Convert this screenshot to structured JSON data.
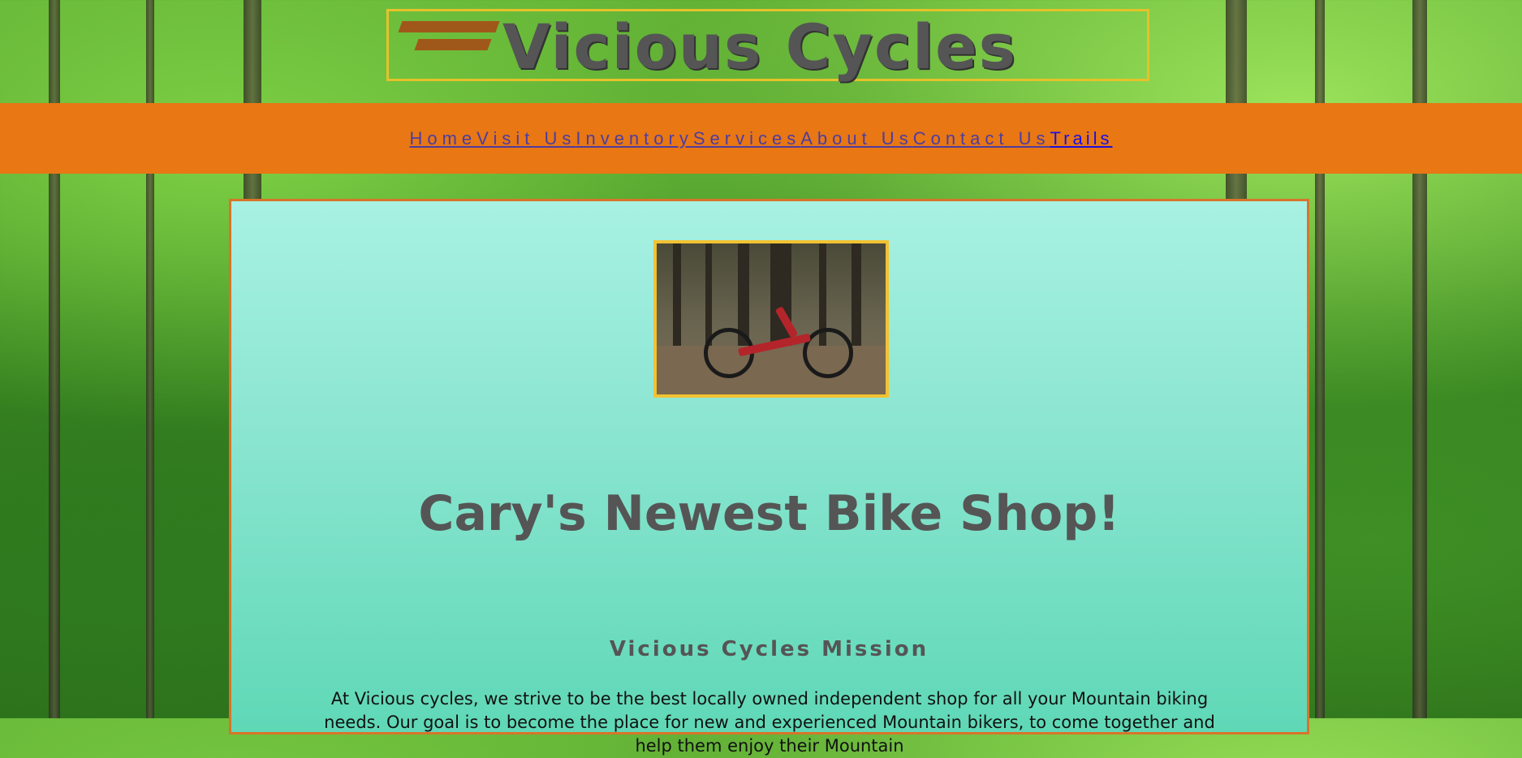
{
  "brand": {
    "logo_text": "Vicious Cycles"
  },
  "nav": {
    "items": [
      {
        "label": "Home"
      },
      {
        "label": "Visit Us"
      },
      {
        "label": "Inventory"
      },
      {
        "label": "Services"
      },
      {
        "label": "About Us"
      },
      {
        "label": "Contact Us"
      },
      {
        "label": "Trails"
      }
    ]
  },
  "main": {
    "headline": "Cary's Newest Bike Shop!",
    "mission_title": "Vicious Cycles Mission",
    "mission_text": "At Vicious cycles, we strive to be the best locally owned independent shop for all your Mountain biking needs. Our goal is to become the place for new and experienced Mountain bikers, to come together and help them enjoy their Mountain"
  },
  "colors": {
    "nav_bar": "#e87714",
    "card_top": "#a8f1e3",
    "card_bottom": "#5fd8b6",
    "logo_border": "#e6c22a"
  }
}
